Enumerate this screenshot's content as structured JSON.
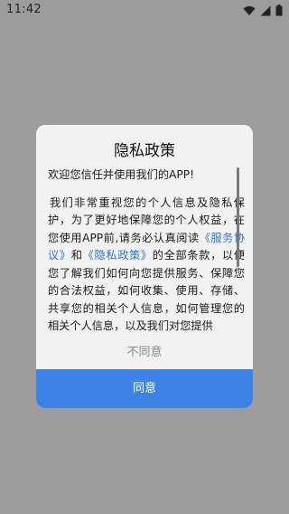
{
  "status_bar": {
    "time": "11:42"
  },
  "dialog": {
    "title": "隐私政策",
    "welcome": "欢迎您信任并使用我们的APP!",
    "body_part1": "我们非常重视您的个人信息及隐私保护，为了更好地保障您的个人权益，在您使用APP前,请务必认真阅读",
    "link_service": "《服务协议》",
    "body_and": "和",
    "link_privacy": "《隐私政策》",
    "body_part2": "的全部条款，以便您了解我们如何向您提供服务、保障您的合法权益，如何收集、使用、存储、共享您的相关个人信息，如何管理您的相关个人信息，以及我们对您提供",
    "disagree_label": "不同意",
    "agree_label": "同意"
  },
  "colors": {
    "overlay": "#9c9c9c",
    "link": "#2f73d6",
    "agree_button": "#3d83e6"
  },
  "icons": [
    "wifi-icon",
    "signal-icon",
    "battery-icon"
  ]
}
